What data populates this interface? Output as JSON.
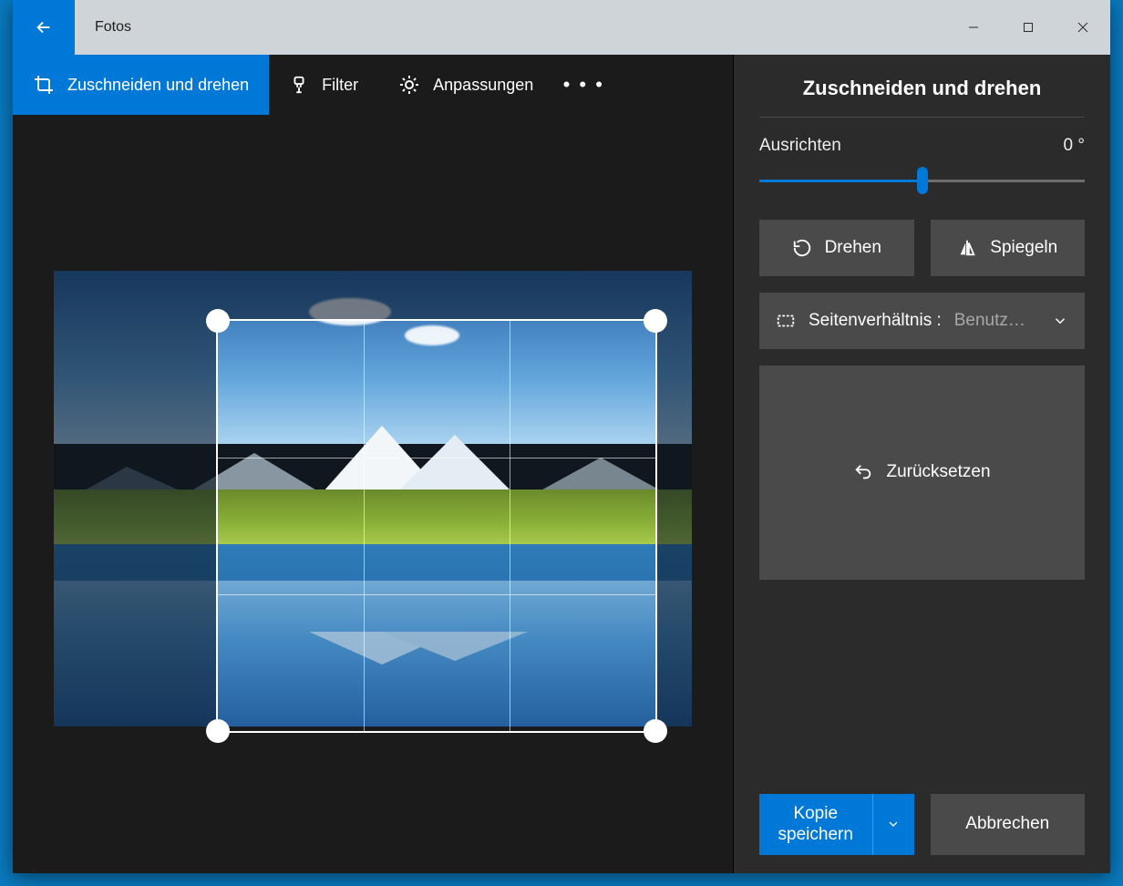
{
  "window": {
    "title": "Fotos"
  },
  "toolbar": {
    "tabs": [
      {
        "label": "Zuschneiden und drehen"
      },
      {
        "label": "Filter"
      },
      {
        "label": "Anpassungen"
      }
    ]
  },
  "panel": {
    "title": "Zuschneiden und drehen",
    "align_label": "Ausrichten",
    "align_value": "0 °",
    "rotate_label": "Drehen",
    "flip_label": "Spiegeln",
    "aspect_label": "Seitenverhältnis :",
    "aspect_value": "Benutz…",
    "reset_label": "Zurücksetzen",
    "save_label": "Kopie speichern",
    "cancel_label": "Abbrechen"
  }
}
